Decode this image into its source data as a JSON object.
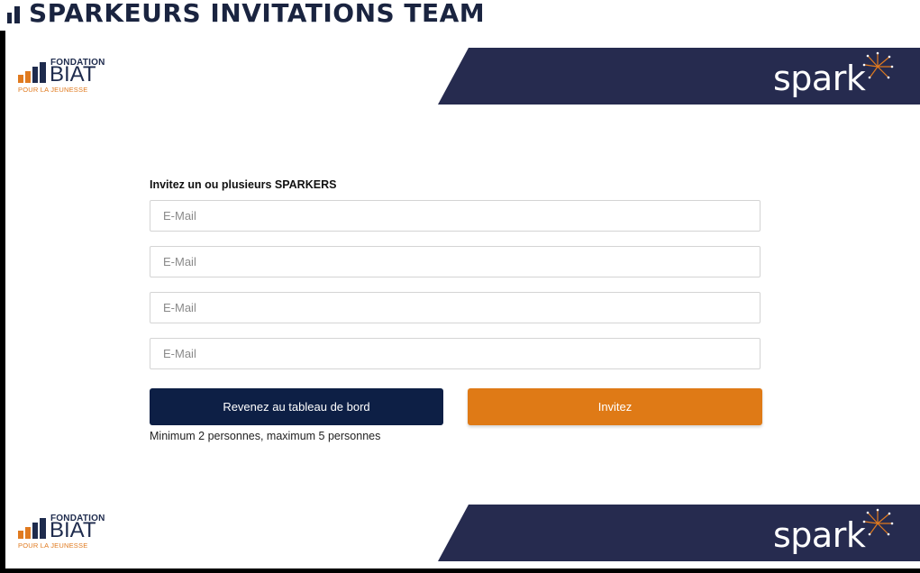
{
  "header": {
    "title": "SPARKEURS INVITATIONS TEAM",
    "icon": "bar-chart-icon"
  },
  "brand": {
    "fondation": "FONDATION",
    "name": "BIAT",
    "tagline": "POUR LA JEUNESSE",
    "spark_word": "spark",
    "spark_icon": "firework-icon",
    "colors": {
      "navy": "#1e2b4d",
      "orange": "#df7a16",
      "banner": "#262b4f",
      "button_dark": "#0d1f45"
    }
  },
  "form": {
    "heading": "Invitez un ou plusieurs SPARKERS",
    "email_placeholders": [
      "E-Mail",
      "E-Mail",
      "E-Mail",
      "E-Mail"
    ],
    "email_values": [
      "",
      "",
      "",
      ""
    ],
    "back_button": "Revenez au tableau de bord",
    "invite_button": "Invitez",
    "hint": "Minimum 2 personnes, maximum 5 personnes"
  }
}
